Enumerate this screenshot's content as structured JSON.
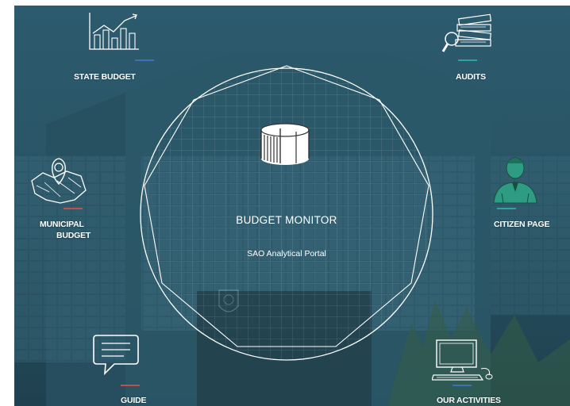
{
  "portal": {
    "title": "BUDGET MONITOR",
    "subtitle": "SAO Analytical Portal"
  },
  "nav": {
    "state_budget": {
      "label": "STATE BUDGET",
      "icon": "bar-chart-icon",
      "accent": "#3b6fb6"
    },
    "audits": {
      "label": "AUDITS",
      "icon": "audit-books-icon",
      "accent": "#2fa59a"
    },
    "municipal_budget": {
      "line1": "MUNICIPAL",
      "line2": "BUDGET",
      "icon": "map-pin-icon",
      "accent": "#c0504d"
    },
    "citizen_page": {
      "label": "CITIZEN PAGE",
      "icon": "citizen-icon",
      "accent": "#2fa59a"
    },
    "guide": {
      "label": "GUIDE",
      "icon": "chat-bubble-icon",
      "accent": "#c0504d"
    },
    "our_activities": {
      "label": "OUR ACTIVITIES",
      "icon": "computer-icon",
      "accent": "#3b6fb6"
    }
  },
  "colors": {
    "background": "#2a5566",
    "line": "#ffffff",
    "citizen_icon": "#2e9c82"
  }
}
